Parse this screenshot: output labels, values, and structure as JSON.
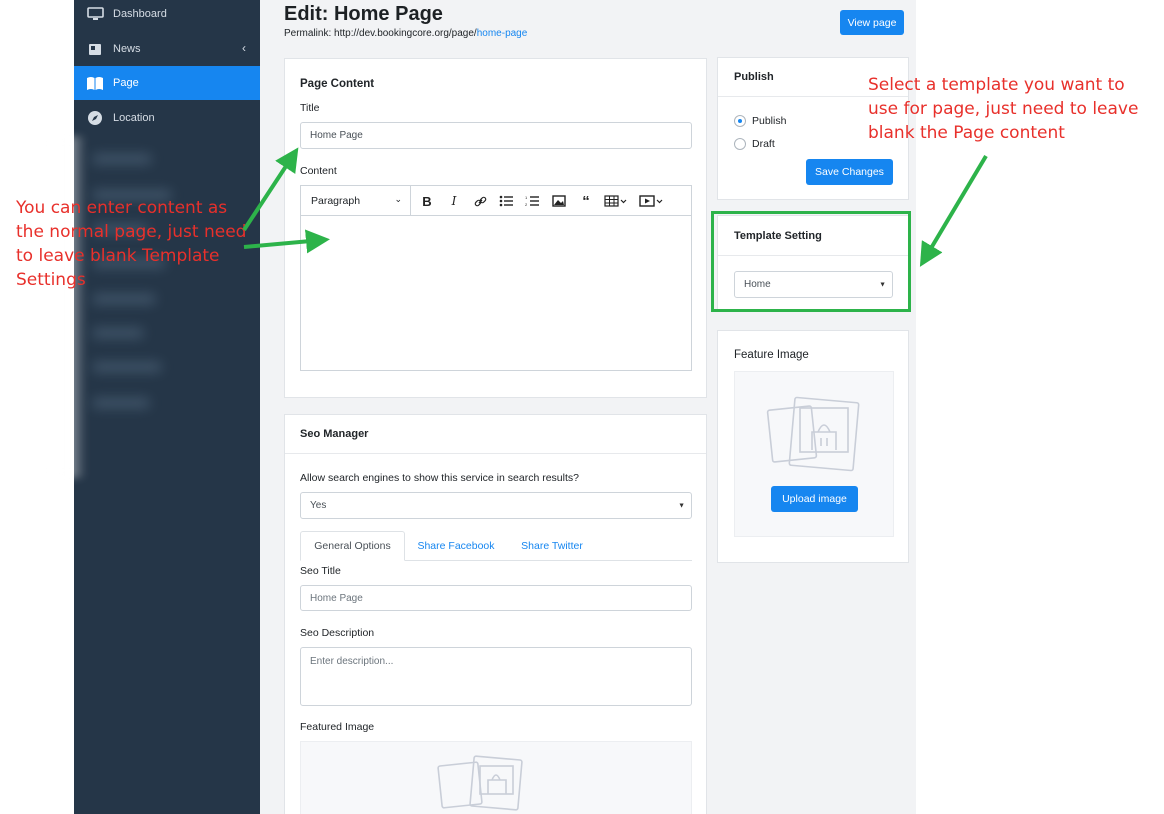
{
  "sidebar": {
    "items": [
      {
        "label": "Dashboard",
        "icon": "monitor-icon"
      },
      {
        "label": "News",
        "icon": "newspaper-icon"
      },
      {
        "label": "Page",
        "icon": "book-icon"
      },
      {
        "label": "Location",
        "icon": "compass-icon"
      }
    ],
    "news_caret": "‹"
  },
  "header": {
    "title": "Edit: Home Page",
    "permalink_prefix": "Permalink: http://dev.bookingcore.org/page/",
    "permalink_slug": "home-page",
    "view_page_label": "View page"
  },
  "page_content": {
    "heading": "Page Content",
    "title_label": "Title",
    "title_value": "Home Page",
    "content_label": "Content",
    "format_select": "Paragraph",
    "toolbar_icons": [
      "bold-icon",
      "italic-icon",
      "link-icon",
      "bulleted-list-icon",
      "numbered-list-icon",
      "image-icon",
      "quote-icon",
      "table-icon",
      "media-icon"
    ]
  },
  "seo": {
    "heading": "Seo Manager",
    "allow_label": "Allow search engines to show this service in search results?",
    "allow_value": "Yes",
    "tabs": [
      "General Options",
      "Share Facebook",
      "Share Twitter"
    ],
    "seo_title_label": "Seo Title",
    "seo_title_placeholder": "Home Page",
    "seo_desc_label": "Seo Description",
    "seo_desc_placeholder": "Enter description...",
    "featured_image_label": "Featured Image"
  },
  "publish": {
    "heading": "Publish",
    "options": [
      "Publish",
      "Draft"
    ],
    "selected": "Publish",
    "save_label": "Save Changes"
  },
  "template_setting": {
    "heading": "Template Setting",
    "value": "Home"
  },
  "feature_image": {
    "heading": "Feature Image",
    "upload_label": "Upload image"
  },
  "annotations": {
    "left_note": [
      "You can enter content as",
      "the normal page, just need",
      "to leave blank  Template",
      "Settings"
    ],
    "right_note": [
      "Select a template you want to",
      "use for page, just need to leave",
      "blank the Page content"
    ]
  },
  "colors": {
    "sidebar_bg": "#253648",
    "accent": "#1686f0",
    "annotation_text": "#e8302b",
    "annotation_arrow": "#2db34a"
  }
}
